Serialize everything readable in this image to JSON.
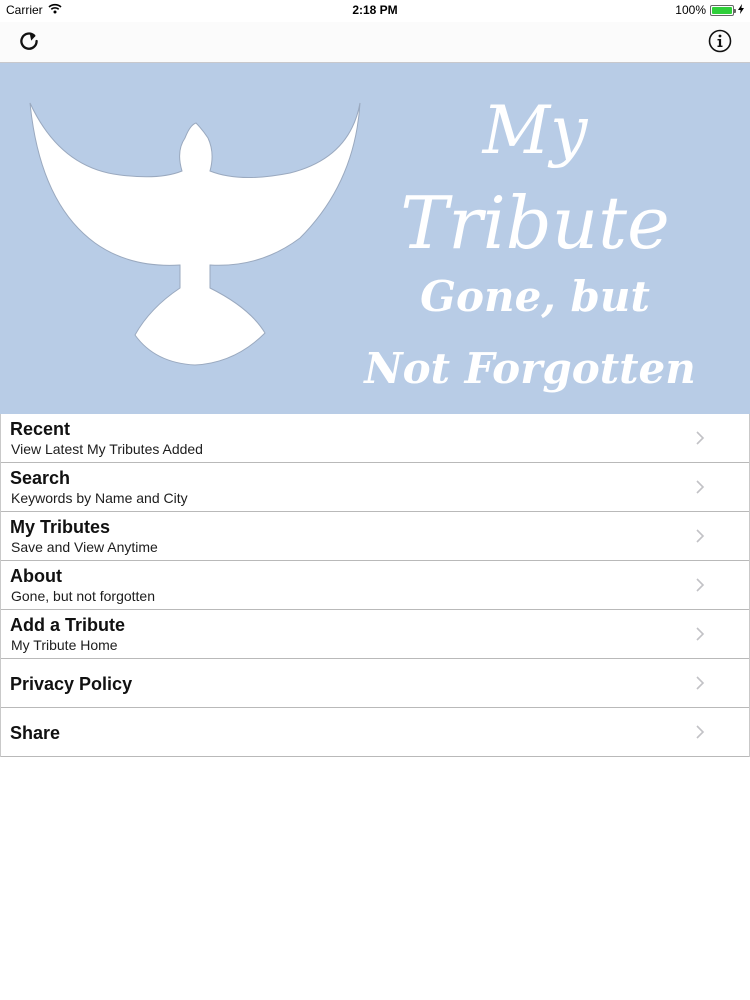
{
  "status_bar": {
    "carrier": "Carrier",
    "time": "2:18 PM",
    "battery": "100%",
    "battery_level": 1.0
  },
  "nav": {
    "left_icon": "refresh-icon",
    "right_icon": "info-icon"
  },
  "banner": {
    "line1": "My",
    "line2": "Tribute",
    "line3": "Gone, but",
    "line4": "Not Forgotten",
    "bg_color": "#b8cce6"
  },
  "menu": [
    {
      "title": "Recent",
      "subtitle": "View Latest My Tributes Added"
    },
    {
      "title": "Search",
      "subtitle": "Keywords by Name and City"
    },
    {
      "title": "My Tributes",
      "subtitle": "Save and View Anytime"
    },
    {
      "title": "About",
      "subtitle": "Gone, but not forgotten"
    },
    {
      "title": "Add a Tribute",
      "subtitle": "My Tribute Home"
    },
    {
      "title": "Privacy Policy",
      "subtitle": ""
    },
    {
      "title": "Share",
      "subtitle": ""
    }
  ]
}
